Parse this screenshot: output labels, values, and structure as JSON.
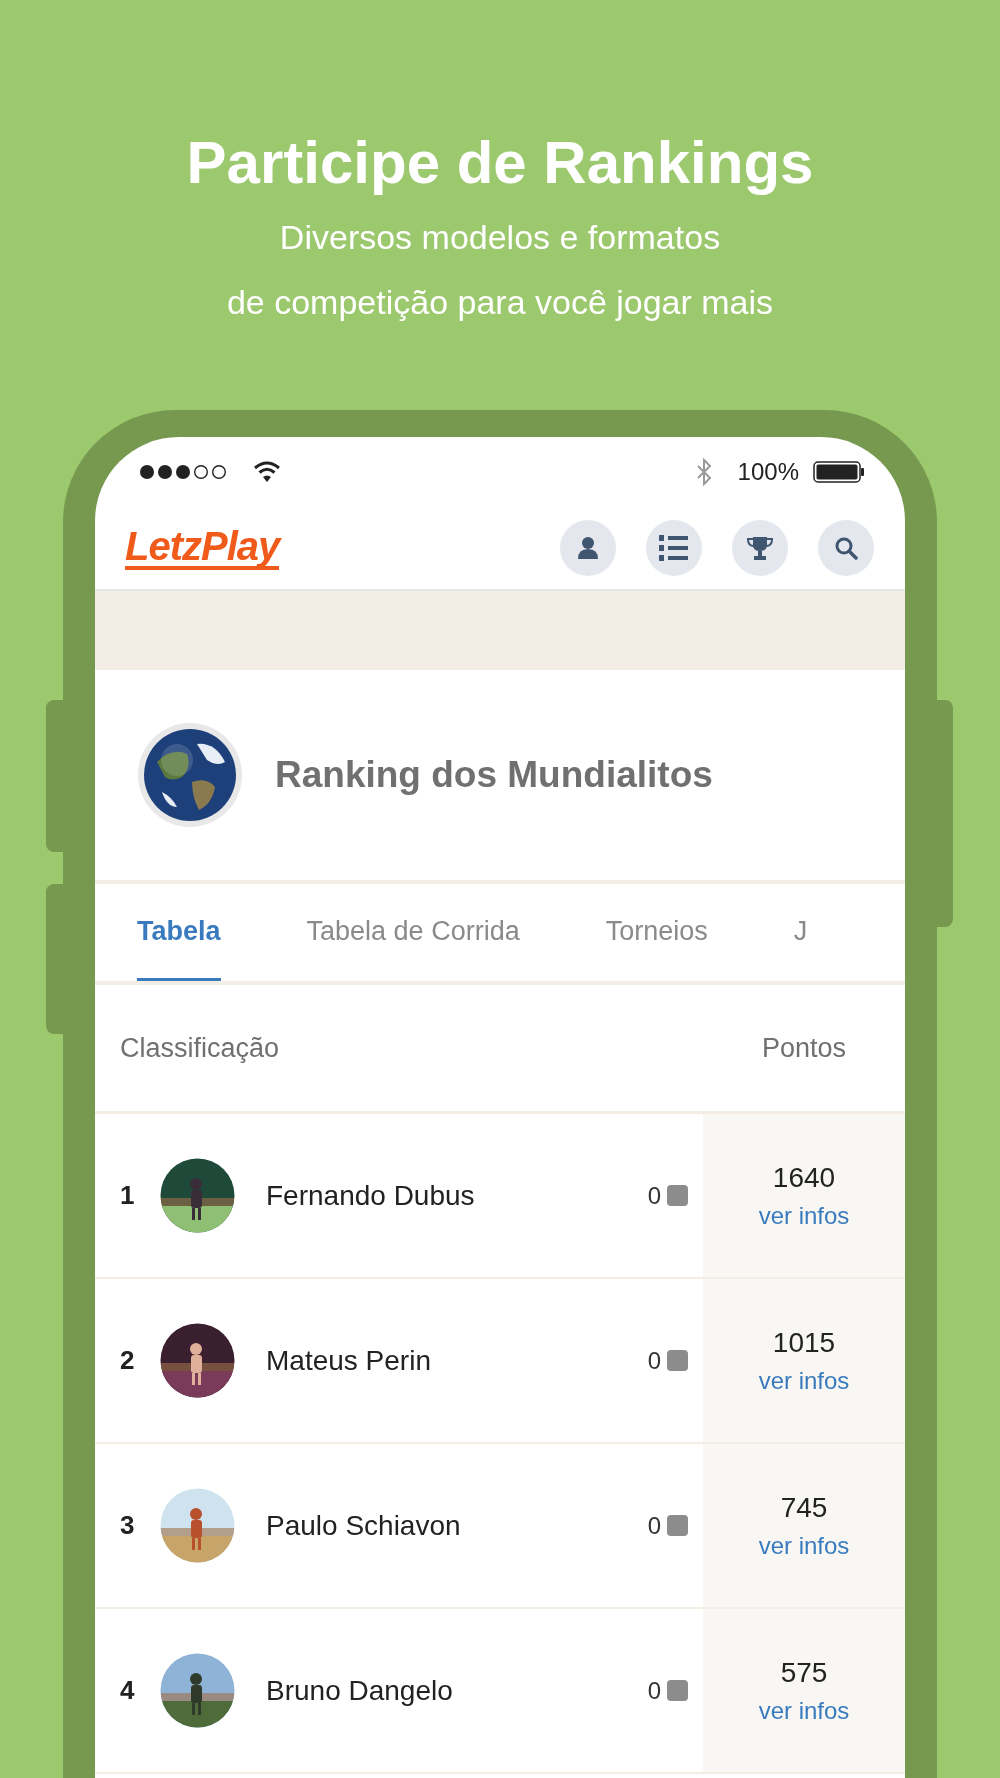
{
  "headline": {
    "title": "Participe de Rankings",
    "subtitle_lines": [
      "Diversos modelos e formatos",
      "de competição para você jogar mais"
    ]
  },
  "status_bar": {
    "battery": "100%"
  },
  "app_bar": {
    "logo": "LetzPlay"
  },
  "ranking": {
    "title": "Ranking dos Mundialitos"
  },
  "tabs": [
    {
      "label": "Tabela",
      "selected": true
    },
    {
      "label": "Tabela de Corrida",
      "selected": false
    },
    {
      "label": "Torneios",
      "selected": false
    },
    {
      "label": "J",
      "selected": false
    }
  ],
  "table": {
    "columns": [
      "Classificação",
      "Pontos"
    ],
    "rows": [
      {
        "rank": "1",
        "name": "Fernando Dubus",
        "count": "0",
        "points": "1640",
        "link": "ver infos"
      },
      {
        "rank": "2",
        "name": "Mateus Perin",
        "count": "0",
        "points": "1015",
        "link": "ver infos"
      },
      {
        "rank": "3",
        "name": "Paulo Schiavon",
        "count": "0",
        "points": "745",
        "link": "ver infos"
      },
      {
        "rank": "4",
        "name": "Bruno Dangelo",
        "count": "0",
        "points": "575",
        "link": "ver infos"
      }
    ]
  }
}
